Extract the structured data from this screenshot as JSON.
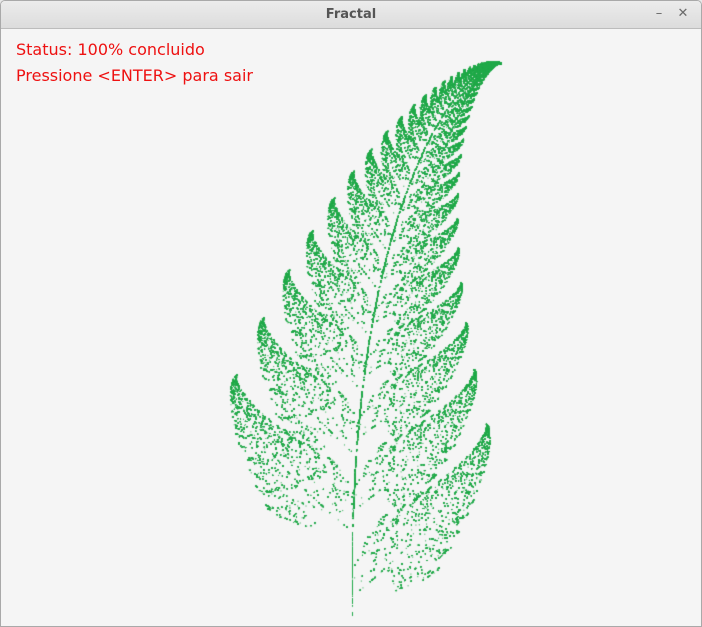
{
  "window": {
    "title": "Fractal",
    "minimize_glyph": "–",
    "close_glyph": "✕"
  },
  "canvas": {
    "status_line": "Status: 100% concluido",
    "instruction_line": "Pressione <ENTER> para sair",
    "text_color": "#ee1111",
    "fern_color": "#22aa4a",
    "background_color": "#f5f5f5",
    "progress_percent": 100
  }
}
